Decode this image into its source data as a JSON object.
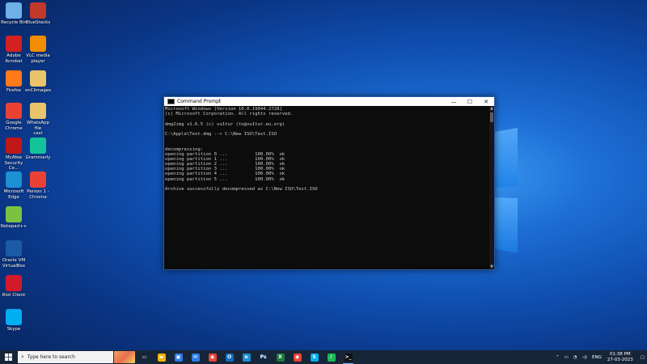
{
  "desktop": {
    "icons": [
      {
        "label": "Recycle Bin",
        "icon": "recycle-bin-icon",
        "color": "#6fb0e8"
      },
      {
        "label": "BlueStacks",
        "icon": "app-icon",
        "color": "#c0392b"
      },
      {
        "label": "Adobe\nAcrobat",
        "icon": "pdf-icon",
        "color": "#d32020"
      },
      {
        "label": "VLC media\nplayer",
        "icon": "vlc-icon",
        "color": "#f28c00"
      },
      {
        "label": "Firefox",
        "icon": "firefox-icon",
        "color": "#ff7a1a"
      },
      {
        "label": "onClimages",
        "icon": "folder-icon",
        "color": "#e9c46a"
      },
      {
        "label": "Google\nChrome",
        "icon": "chrome-icon",
        "color": "#e94235"
      },
      {
        "label": "WhatsApp file\ncast",
        "icon": "folder-icon",
        "color": "#e9c46a"
      },
      {
        "label": "McAfee\nSecurity Ce...",
        "icon": "mcafee-icon",
        "color": "#c01818"
      },
      {
        "label": "Grammarly",
        "icon": "grammarly-icon",
        "color": "#15c39a"
      },
      {
        "label": "Microsoft\nEdge",
        "icon": "edge-icon",
        "color": "#1e90d4"
      },
      {
        "label": "Person 1 -\nChrome",
        "icon": "chrome-icon",
        "color": "#e94235"
      },
      {
        "label": "Notepad++",
        "icon": "notepad-icon",
        "color": "#7cc242"
      },
      {
        "label": "Oracle VM\nVirtualBox",
        "icon": "virtualbox-icon",
        "color": "#1b5aa6"
      },
      {
        "label": "Riot Client",
        "icon": "riot-icon",
        "color": "#d31a2a"
      },
      {
        "label": "Skype",
        "icon": "skype-icon",
        "color": "#00aff0"
      }
    ]
  },
  "window": {
    "title": "Command Prompt",
    "minimize": "—",
    "maximize": "☐",
    "close": "✕"
  },
  "console": {
    "lines": [
      "Microsoft Windows [Version 10.0.19044.2728]",
      "(c) Microsoft Corporation. All rights reserved.",
      "",
      "dmg2img v1.6.5 (c) vu1tur (to@vu1tur.eu.org)",
      "",
      "C:\\Apple\\Test.dmg --> C:\\New ISO\\Test.ISO",
      "",
      "",
      "decompressing:",
      "opening partition 0 ...          100.00%  ok",
      "opening partition 1 ...          100.00%  ok",
      "opening partition 2 ...          100.00%  ok",
      "opening partition 3 ...          100.00%  ok",
      "opening partition 4 ...          100.00%  ok",
      "opening partition 5 ...          100.00%  ok",
      "",
      "Archive successfully decompressed as C:\\New ISO\\Test.ISO"
    ]
  },
  "taskbar": {
    "search_placeholder": "Type here to search",
    "apps": [
      {
        "name": "task-view",
        "glyph": "▭",
        "color": "#172538"
      },
      {
        "name": "file-explorer",
        "glyph": "▬",
        "color": "#f0b400"
      },
      {
        "name": "store",
        "glyph": "▣",
        "color": "#2c7be5"
      },
      {
        "name": "mail",
        "glyph": "✉",
        "color": "#2c7be5"
      },
      {
        "name": "chrome",
        "glyph": "◉",
        "color": "#e94235"
      },
      {
        "name": "outlook",
        "glyph": "O",
        "color": "#0f6cbd"
      },
      {
        "name": "edge",
        "glyph": "e",
        "color": "#1e90d4"
      },
      {
        "name": "photoshop",
        "glyph": "Ps",
        "color": "#0d2a4a"
      },
      {
        "name": "excel",
        "glyph": "X",
        "color": "#1d7a3e"
      },
      {
        "name": "chrome-2",
        "glyph": "◉",
        "color": "#e94235"
      },
      {
        "name": "skype",
        "glyph": "S",
        "color": "#00aff0"
      },
      {
        "name": "spotify",
        "glyph": "♪",
        "color": "#1db954"
      },
      {
        "name": "command-prompt",
        "glyph": ">_",
        "color": "#111111",
        "active": true
      }
    ],
    "tray": {
      "language": "ENG",
      "time": "01:38 PM",
      "date": "27-03-2023"
    }
  }
}
